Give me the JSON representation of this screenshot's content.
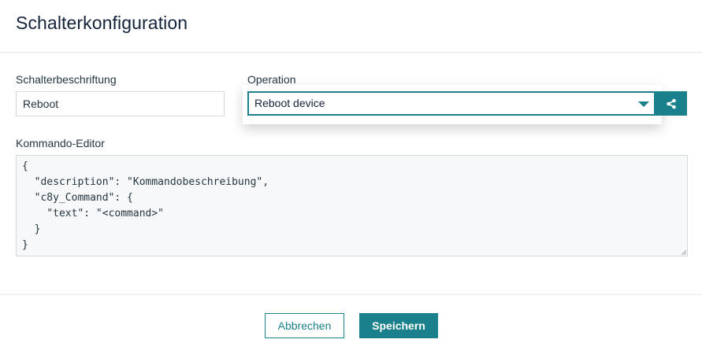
{
  "dialog": {
    "title": "Schalterkonfiguration"
  },
  "form": {
    "label_field": {
      "label": "Schalterbeschriftung",
      "value": "Reboot"
    },
    "operation": {
      "label": "Operation",
      "selected": "Reboot device",
      "caret_icon": "chevron-down-icon",
      "share_icon": "share-icon"
    },
    "editor": {
      "label": "Kommando-Editor",
      "content": "{\n  \"description\": \"Kommandobeschreibung\",\n  \"c8y_Command\": {\n    \"text\": \"<command>\"\n  }\n}"
    }
  },
  "footer": {
    "cancel_label": "Abbrechen",
    "save_label": "Speichern"
  },
  "colors": {
    "accent": "#1a808b",
    "title": "#14233a",
    "border": "#d4dadc",
    "editor_bg": "#f7f8f9"
  }
}
